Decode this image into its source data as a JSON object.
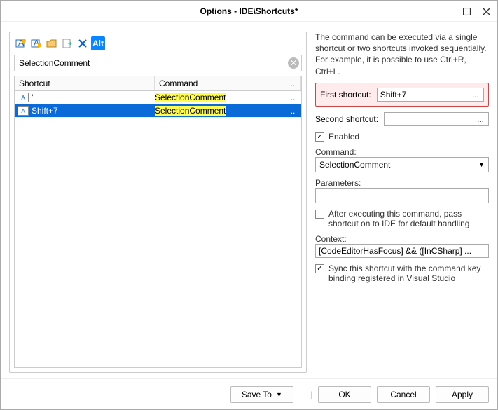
{
  "window": {
    "title": "Options - IDE\\Shortcuts*"
  },
  "toolbar": {
    "alt_label": "Alt"
  },
  "search": {
    "value": "SelectionComment"
  },
  "grid": {
    "headers": {
      "shortcut": "Shortcut",
      "command": "Command",
      "more": ".."
    },
    "rows": [
      {
        "shortcut": "'",
        "command": "SelectionComment",
        "selected": false
      },
      {
        "shortcut": "Shift+7",
        "command": "SelectionComment",
        "selected": true
      }
    ]
  },
  "description": "The command can be executed via a single shortcut or two shortcuts invoked sequentially. For example, it is possible to use Ctrl+R, Ctrl+L.",
  "first_shortcut": {
    "label": "First shortcut:",
    "value": "Shift+7"
  },
  "second_shortcut": {
    "label": "Second shortcut:",
    "value": ""
  },
  "enabled": {
    "label": "Enabled",
    "checked": true
  },
  "command": {
    "label": "Command:",
    "value": "SelectionComment"
  },
  "parameters": {
    "label": "Parameters:",
    "value": ""
  },
  "pass_to_ide": {
    "label": "After executing this command, pass shortcut on to IDE for default handling",
    "checked": false
  },
  "context": {
    "label": "Context:",
    "value": "[CodeEditorHasFocus] && ([InCSharp]  ..."
  },
  "sync": {
    "label": "Sync this shortcut with the command key binding registered in Visual Studio",
    "checked": true
  },
  "footer": {
    "save_to": "Save To",
    "ok": "OK",
    "cancel": "Cancel",
    "apply": "Apply"
  }
}
